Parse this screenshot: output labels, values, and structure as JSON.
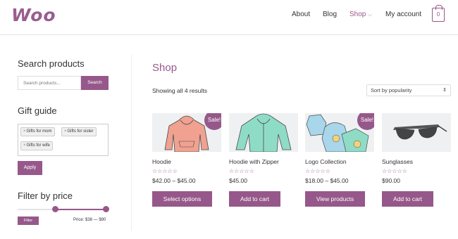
{
  "header": {
    "logo": "Woo",
    "nav": [
      {
        "label": "About"
      },
      {
        "label": "Blog"
      },
      {
        "label": "Shop",
        "chevron": "⌵"
      },
      {
        "label": "My account"
      }
    ],
    "cart_count": "0"
  },
  "sidebar": {
    "search_title": "Search products",
    "search_placeholder": "Search products...",
    "search_button": "Search",
    "gift_title": "Gift guide",
    "tags": [
      "Gifts for mom",
      "Gifts for sister",
      "Gifts for wife"
    ],
    "apply_button": "Apply",
    "price_title": "Filter by price",
    "filter_button": "Filter",
    "price_range_label": "Price: $38 — $90",
    "price_range": {
      "min": 38,
      "max": 90,
      "selected_min_fraction": 0.41,
      "selected_max_fraction": 1.0
    }
  },
  "main": {
    "title": "Shop",
    "result_count": "Showing all 4 results",
    "sort_selected": "Sort by popularity",
    "products": [
      {
        "name": "Hoodie",
        "price": "$42.00 – $45.00",
        "sale": "Sale!",
        "button": "Select options",
        "stars": "☆☆☆☆☆"
      },
      {
        "name": "Hoodie with Zipper",
        "price": "$45.00",
        "sale": "",
        "button": "Add to cart",
        "stars": "☆☆☆☆☆"
      },
      {
        "name": "Logo Collection",
        "price": "$18.00 – $45.00",
        "sale": "Sale!",
        "button": "View products",
        "stars": "☆☆☆☆☆"
      },
      {
        "name": "Sunglasses",
        "price": "$90.00",
        "sale": "",
        "button": "Add to cart",
        "stars": "☆☆☆☆☆"
      }
    ]
  },
  "colors": {
    "accent": "#96588a",
    "image_bg": "#eef0f2"
  }
}
